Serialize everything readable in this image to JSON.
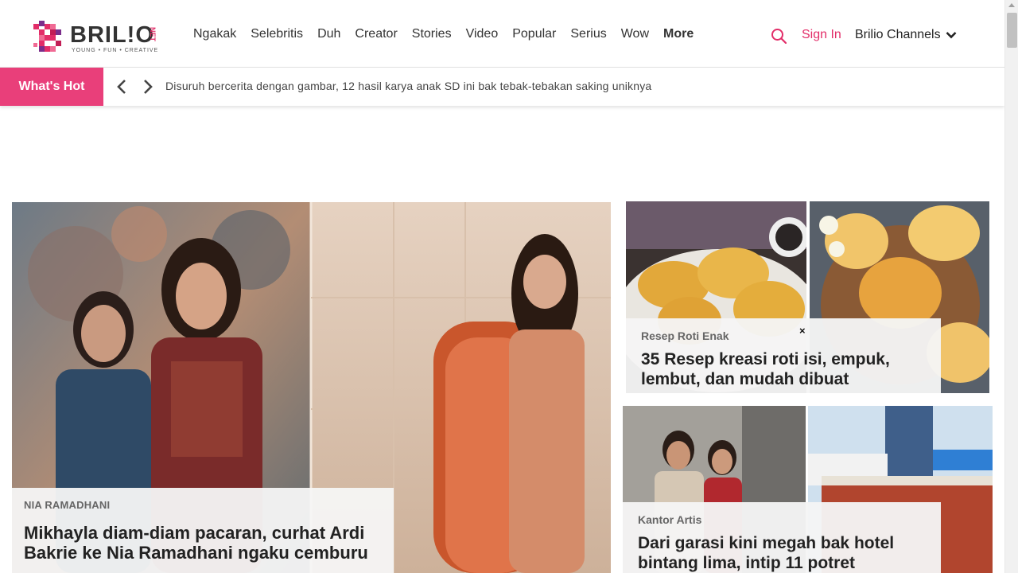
{
  "brand": {
    "name": "BRIL!O",
    "suffix": "NET",
    "tagline": "YOUNG • FUN • CREATIVE",
    "accent_color": "#e22d68"
  },
  "nav": {
    "items": [
      "Ngakak",
      "Selebritis",
      "Duh",
      "Creator",
      "Stories",
      "Video",
      "Popular",
      "Serius",
      "Wow",
      "More"
    ],
    "search_icon": "search-icon",
    "signin_label": "Sign In",
    "channels_label": "Brilio Channels"
  },
  "whats_hot": {
    "label": "What's Hot",
    "headline": "Disuruh bercerita dengan gambar, 12 hasil karya anak SD ini bak tebak-tebakan saking uniknya"
  },
  "feature": {
    "category": "NIA RAMADHANI",
    "title": "Mikhayla diam-diam pacaran, curhat Ardi Bakrie ke Nia Ramadhani ngaku cemburu"
  },
  "side_stories": [
    {
      "category": "Resep Roti Enak",
      "title": "35 Resep kreasi roti isi, empuk, lembut, dan mudah dibuat"
    },
    {
      "category": "Kantor Artis",
      "title": "Dari garasi kini megah bak hotel bintang lima, intip 11 potret"
    }
  ],
  "close_label": "×"
}
